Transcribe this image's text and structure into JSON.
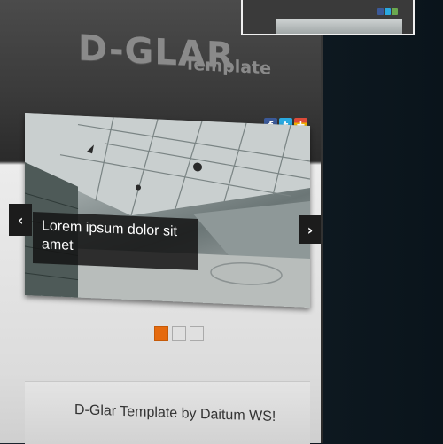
{
  "header": {
    "logo": "D-GLAR",
    "logo_subtitle": "Template"
  },
  "social": {
    "facebook": "f",
    "twitter": "t",
    "googleplus": "+"
  },
  "slider": {
    "caption": "Lorem ipsum dolor sit amet",
    "prev_label": "‹",
    "next_label": "›",
    "active_index": 0,
    "dot_count": 3,
    "accent_color": "#e56a0e"
  },
  "footer": {
    "text": "D-Glar Template by Daitum WS!"
  },
  "colors": {
    "background": "#0f1a22",
    "header": "#3a3a3a",
    "facebook": "#3b5998",
    "twitter": "#2aa9e0"
  }
}
